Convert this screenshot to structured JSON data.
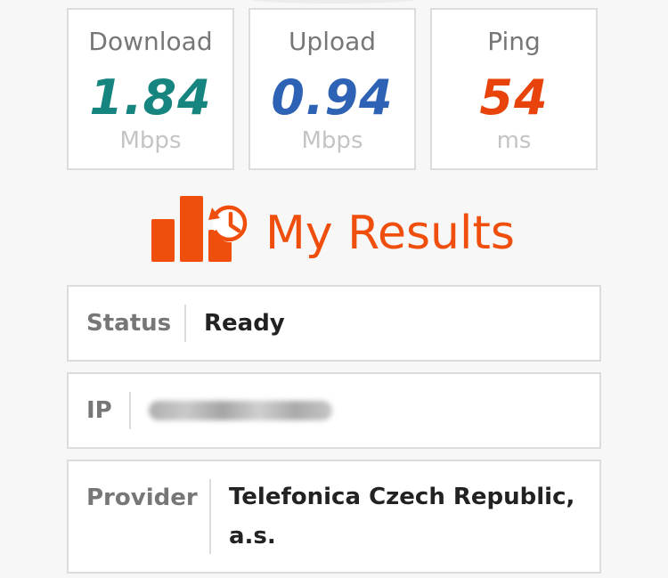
{
  "stats": [
    {
      "label": "Download",
      "value": "1.84",
      "unit": "Mbps",
      "color": "#17857f"
    },
    {
      "label": "Upload",
      "value": "0.94",
      "unit": "Mbps",
      "color": "#2e62b5"
    },
    {
      "label": "Ping",
      "value": "54",
      "unit": "ms",
      "color": "#e8430a"
    }
  ],
  "results": {
    "title": "My Results",
    "icon": "results-history-icon",
    "accent": "#f04e0c"
  },
  "info": {
    "status": {
      "label": "Status",
      "value": "Ready"
    },
    "ip": {
      "label": "IP",
      "value": ""
    },
    "provider": {
      "label": "Provider",
      "value": "Telefonica Czech Republic, a.s."
    }
  }
}
